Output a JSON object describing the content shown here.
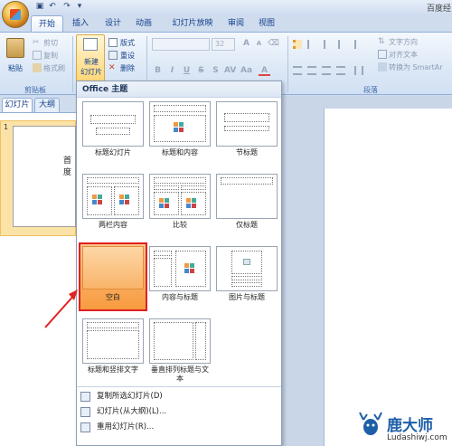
{
  "window": {
    "app_title": "百度经"
  },
  "quick_access": [
    "save-icon",
    "undo-icon",
    "redo-icon",
    "customize-icon"
  ],
  "tabs": [
    {
      "label": "开始",
      "active": true
    },
    {
      "label": "插入"
    },
    {
      "label": "设计"
    },
    {
      "label": "动画"
    },
    {
      "label": "幻灯片放映"
    },
    {
      "label": "审阅"
    },
    {
      "label": "视图"
    }
  ],
  "clipboard": {
    "paste": "粘贴",
    "cut": "剪切",
    "copy": "复制",
    "format_painter": "格式刷",
    "group_label": "剪贴板"
  },
  "slides_group": {
    "new_slide": "新建",
    "new_slide_2": "幻灯片",
    "layout": "版式",
    "reset": "重设",
    "delete": "删除"
  },
  "font_group": {
    "font_size": "32"
  },
  "paragraph_group": {
    "text_direction": "文字方向",
    "align_text": "对齐文本",
    "convert_smartart": "转换为 SmartAr",
    "group_label": "段落"
  },
  "left_panel": {
    "tab_slides": "幻灯片",
    "tab_outline": "大纲",
    "thumb_number": "1",
    "thumb_text": "首度"
  },
  "dropdown": {
    "header": "Office 主题",
    "layouts": [
      "标题幻灯片",
      "标题和内容",
      "节标题",
      "两栏内容",
      "比较",
      "仅标题",
      "空白",
      "内容与标题",
      "图片与标题",
      "标题和竖排文字",
      "垂直排列标题与文",
      "本"
    ],
    "menu": [
      "复制所选幻灯片(D)",
      "幻灯片(从大纲)(L)...",
      "重用幻灯片(R)..."
    ]
  },
  "watermark": {
    "name": "鹿大师",
    "url": "Ludashiwj.com"
  }
}
